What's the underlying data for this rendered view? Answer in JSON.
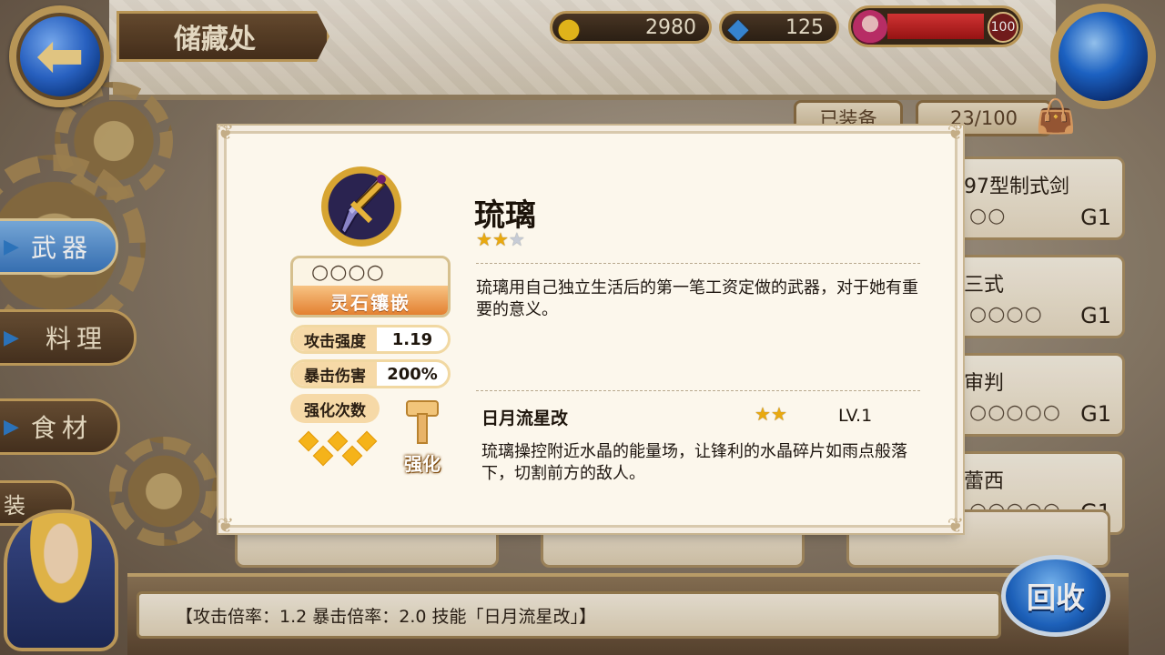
{
  "header": {
    "title": "储藏处",
    "gold": "2980",
    "gems": "125",
    "stamina_value": "100"
  },
  "inventory": {
    "equipped_label": "已装备",
    "capacity": "23/100"
  },
  "side_tabs": [
    {
      "label": "武器",
      "active": true
    },
    {
      "label": "料理",
      "active": false
    },
    {
      "label": "食材",
      "active": false
    },
    {
      "label": "装",
      "active": false
    }
  ],
  "list": [
    {
      "name": "97型制式剑",
      "slots": "○○",
      "grade": "G1"
    },
    {
      "name": "三式",
      "slots": "○○○○",
      "grade": "G1"
    },
    {
      "name": "审判",
      "slots": "○○○○○",
      "grade": "G1"
    },
    {
      "name": "蕾西",
      "slots": "○○○○○",
      "grade": "G1"
    }
  ],
  "detail": {
    "name": "琉璃",
    "stars_filled": 2,
    "stars_total": 3,
    "description": "琉璃用自己独立生活后的第一笔工资定做的武器，对于她有重要的意义。",
    "socket_slots": "○○○○",
    "socket_button": "灵石镶嵌",
    "stats": [
      {
        "label": "攻击强度",
        "value": "1.19"
      },
      {
        "label": "暴击伤害",
        "value": "200%"
      }
    ],
    "enhance_label": "强化次数",
    "enhance_diamonds": 5,
    "enhance_button": "强化",
    "skill": {
      "name": "日月流星改",
      "stars": 2,
      "level": "LV.1",
      "description": "琉璃操控附近水晶的能量场，让锋利的水晶碎片如雨点般落下，切割前方的敌人。"
    }
  },
  "info_bar": "【攻击倍率：1.2 暴击倍率：2.0 技能「日月流星改」】",
  "recycle_button": "回收",
  "colors": {
    "modal_bg": "#fcf7ec",
    "accent_gold": "#c9a35f",
    "star": "#e9a90f",
    "active_tab": "#3b78c0"
  }
}
